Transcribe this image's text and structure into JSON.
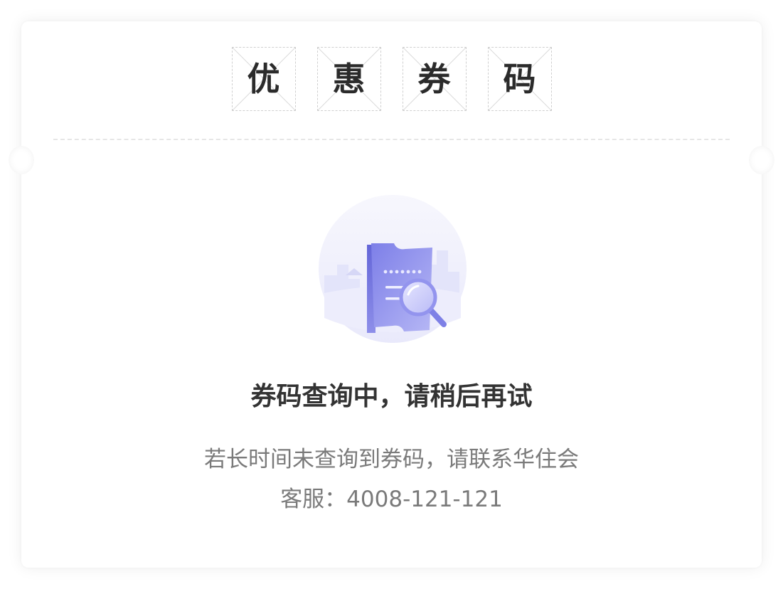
{
  "title": {
    "chars": [
      "优",
      "惠",
      "券",
      "码"
    ]
  },
  "status": {
    "headline": "券码查询中，请稍后再试",
    "desc_line1": "若长时间未查询到券码，请联系华住会",
    "desc_line2": "客服：4008-121-121"
  },
  "illustration": {
    "icon": "coupon-search-icon"
  },
  "colors": {
    "accent": "#8c8cf2",
    "headline": "#333333",
    "desc": "#7a7a7a"
  }
}
